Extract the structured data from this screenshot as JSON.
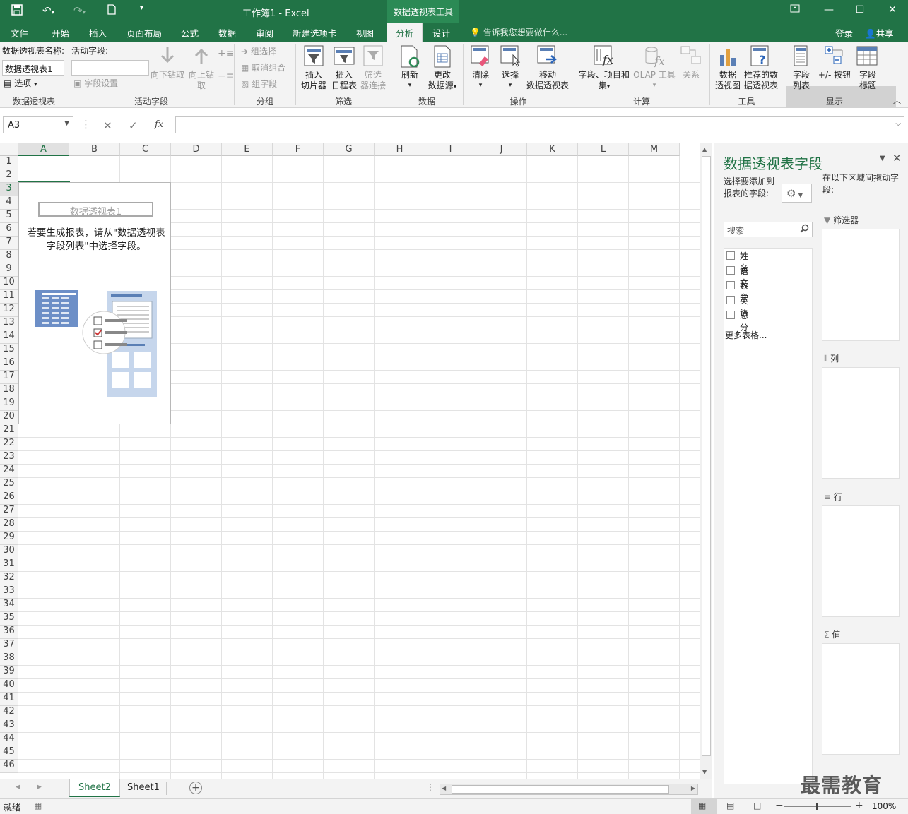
{
  "window": {
    "title": "工作簿1 - Excel",
    "context_tool": "数据透视表工具"
  },
  "tabs": [
    "文件",
    "开始",
    "插入",
    "页面布局",
    "公式",
    "数据",
    "审阅",
    "新建选项卡",
    "视图",
    "分析",
    "设计"
  ],
  "active_tab": "分析",
  "tell_me": "告诉我您想要做什么...",
  "account": {
    "login": "登录",
    "share": "共享"
  },
  "ribbon": {
    "pivot_group": {
      "name_label": "数据透视表名称:",
      "name_value": "数据透视表1",
      "options": "选项",
      "group": "数据透视表"
    },
    "active_field_group": {
      "label": "活动字段:",
      "field_settings": "字段设置",
      "drill_down": "向下钻取",
      "drill_up_1": "向上钻",
      "drill_up_2": "取",
      "group": "活动字段"
    },
    "grouping": {
      "group_sel": "组选择",
      "ungroup": "取消组合",
      "group_field": "组字段",
      "group": "分组"
    },
    "filter": {
      "slicer_1": "插入",
      "slicer_2": "切片器",
      "timeline_1": "插入",
      "timeline_2": "日程表",
      "conn_1": "筛选",
      "conn_2": "器连接",
      "group": "筛选"
    },
    "data": {
      "refresh": "刷新",
      "change_1": "更改",
      "change_2": "数据源",
      "group": "数据"
    },
    "actions": {
      "clear": "清除",
      "select": "选择",
      "move_1": "移动",
      "move_2": "数据透视表",
      "group": "操作"
    },
    "calc": {
      "fields_1": "字段、项目和",
      "fields_2": "集",
      "olap": "OLAP 工具",
      "rel": "关系",
      "group": "计算"
    },
    "tools": {
      "chart_1": "数据",
      "chart_2": "透视图",
      "rec_1": "推荐的数",
      "rec_2": "据透视表",
      "group": "工具"
    },
    "show": {
      "list_1": "字段",
      "list_2": "列表",
      "buttons": "+/- 按钮",
      "headers_1": "字段",
      "headers_2": "标题",
      "group": "显示"
    }
  },
  "formula": {
    "name_box": "A3",
    "fx": "fx"
  },
  "columns": [
    "A",
    "B",
    "C",
    "D",
    "E",
    "F",
    "G",
    "H",
    "I",
    "J",
    "K",
    "L",
    "M"
  ],
  "rows": [
    "1",
    "2",
    "3",
    "4",
    "5",
    "6",
    "7",
    "8",
    "9",
    "10",
    "11",
    "12",
    "13",
    "14",
    "15",
    "16",
    "17",
    "18",
    "19",
    "20",
    "21",
    "22",
    "23",
    "24",
    "25",
    "26",
    "27",
    "28",
    "29",
    "30",
    "31",
    "32",
    "33",
    "34",
    "35",
    "36",
    "37",
    "38",
    "39",
    "40",
    "41",
    "42",
    "43",
    "44",
    "45",
    "46"
  ],
  "pivot_placeholder": {
    "name": "数据透视表1",
    "msg": "若要生成报表，请从\"数据透视表字段列表\"中选择字段。"
  },
  "sheets": [
    "Sheet2",
    "Sheet1"
  ],
  "active_sheet": "Sheet2",
  "status": {
    "ready": "就绪",
    "zoom": "100%"
  },
  "panel": {
    "title": "数据透视表字段",
    "choose_hint": "选择要添加到报表的字段:",
    "drag_hint": "在以下区域间拖动字段:",
    "search_placeholder": "搜索",
    "fields": [
      "姓名",
      "语文",
      "数学",
      "英语",
      "总分"
    ],
    "more_tables": "更多表格...",
    "areas": {
      "filters": "筛选器",
      "columns": "列",
      "rows": "行",
      "values": "值"
    }
  },
  "watermark": "最需教育",
  "colors": {
    "excel_green": "#217346",
    "ribbon_bg": "#f3f3f3"
  }
}
